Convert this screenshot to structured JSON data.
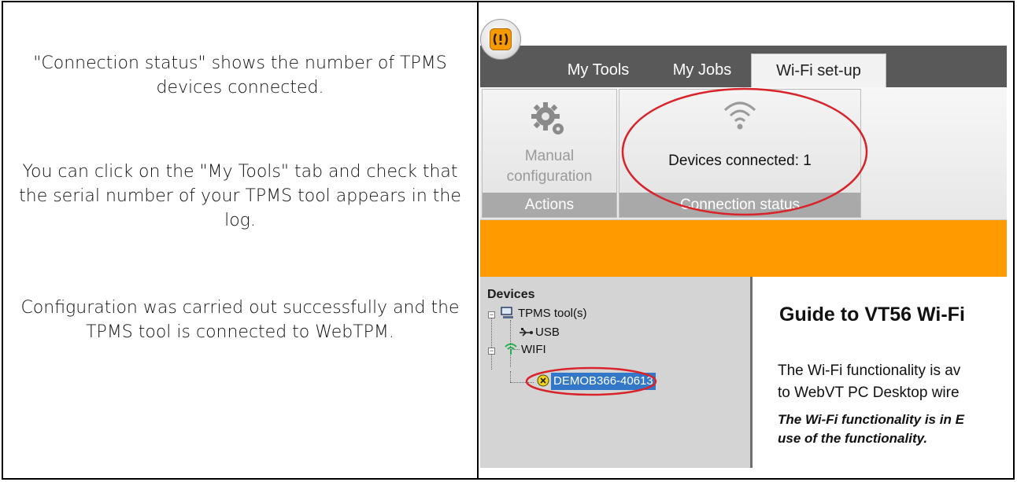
{
  "left_column": {
    "paragraph_1": "\"Connection status\" shows the number of TPMS devices connected.",
    "paragraph_2": "You can click on the \"My Tools\" tab and check that the serial number of your TPMS tool appears in the log.",
    "paragraph_3": "Configuration was carried out successfully and the TPMS tool is connected to WebTPM."
  },
  "app": {
    "tabs": [
      {
        "label": "My Tools",
        "active": false
      },
      {
        "label": "My Jobs",
        "active": false
      },
      {
        "label": "Wi-Fi set-up",
        "active": true
      }
    ],
    "ribbon": {
      "actions_group": {
        "button_label_line1": "Manual",
        "button_label_line2": "configuration",
        "caption": "Actions"
      },
      "connection_group": {
        "status_text": "Devices connected: 1",
        "caption": "Connection status"
      }
    },
    "devices_panel": {
      "title": "Devices",
      "tree": {
        "root": "TPMS tool(s)",
        "usb": "USB",
        "wifi": "WIFI",
        "device": "DEMOB366-40613"
      }
    },
    "guide": {
      "title": "Guide to VT56 Wi-Fi",
      "body_line1": "The Wi-Fi functionality is av",
      "body_line2": "to WebVT PC Desktop wire",
      "note_line1": "The Wi-Fi functionality is in E",
      "note_line2": "use of the functionality."
    }
  },
  "colors": {
    "accent_orange": "#ff9a00",
    "annotation_red": "#d8232a",
    "selection_blue": "#3378c8",
    "tab_bar": "#595959"
  },
  "icons": [
    "gear-icon",
    "wifi-icon",
    "computer-icon",
    "usb-icon",
    "wifi-signal-icon",
    "device-status-icon"
  ]
}
